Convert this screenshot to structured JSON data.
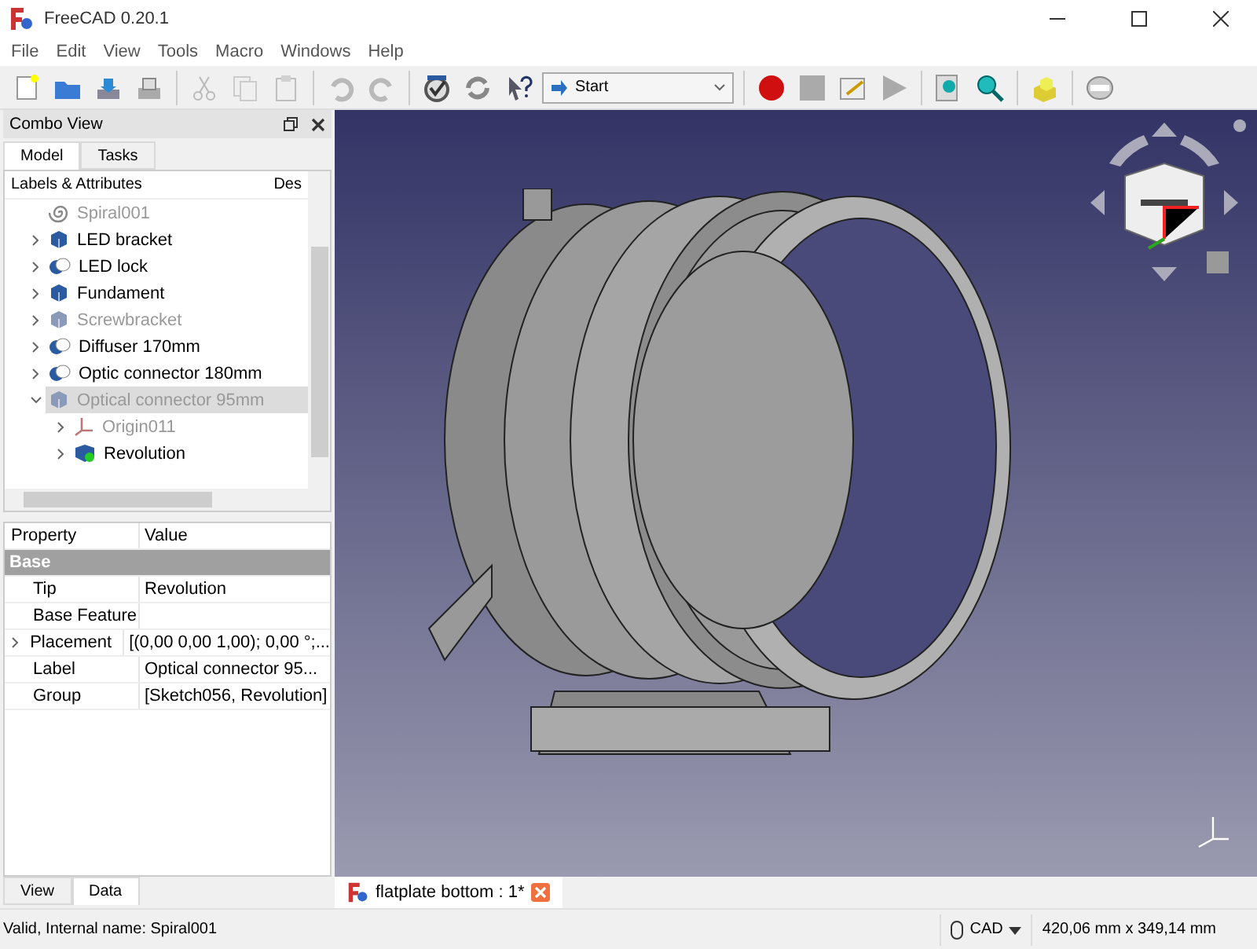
{
  "window": {
    "title": "FreeCAD 0.20.1"
  },
  "menu": [
    "File",
    "Edit",
    "View",
    "Tools",
    "Macro",
    "Windows",
    "Help"
  ],
  "toolbar": [
    {
      "kind": "new",
      "disabled": false
    },
    {
      "kind": "open",
      "disabled": false
    },
    {
      "kind": "save",
      "disabled": false
    },
    {
      "kind": "print",
      "disabled": false
    },
    {
      "kind": "cut",
      "disabled": true
    },
    {
      "kind": "copy",
      "disabled": true
    },
    {
      "kind": "paste",
      "disabled": true
    },
    {
      "kind": "undo",
      "disabled": true
    },
    {
      "kind": "redo",
      "disabled": true
    },
    {
      "kind": "refresh-check",
      "disabled": false
    },
    {
      "kind": "refresh",
      "disabled": false
    },
    {
      "kind": "whatsthis",
      "disabled": false
    }
  ],
  "workbench": "Start",
  "combo_view": {
    "title": "Combo View",
    "tabs": [
      {
        "label": "Model",
        "selected": true
      },
      {
        "label": "Tasks",
        "selected": false
      }
    ]
  },
  "tree": {
    "columns": [
      "Labels & Attributes",
      "Des"
    ],
    "items": [
      {
        "label": "Spiral001",
        "kind": "spiral",
        "visible": false,
        "selected": false,
        "expandable": false
      },
      {
        "label": "LED bracket",
        "kind": "part",
        "visible": true,
        "selected": false,
        "expandable": true,
        "expanded": false
      },
      {
        "label": "LED lock",
        "kind": "body",
        "visible": true,
        "selected": false,
        "expandable": true,
        "expanded": false
      },
      {
        "label": "Fundament",
        "kind": "part",
        "visible": true,
        "selected": false,
        "expandable": true,
        "expanded": false
      },
      {
        "label": "Screwbracket",
        "kind": "part",
        "visible": false,
        "selected": false,
        "expandable": true,
        "expanded": false
      },
      {
        "label": "Diffuser 170mm",
        "kind": "body",
        "visible": true,
        "selected": false,
        "expandable": true,
        "expanded": false
      },
      {
        "label": "Optic connector 180mm",
        "kind": "body",
        "visible": true,
        "selected": false,
        "expandable": true,
        "expanded": false
      },
      {
        "label": "Optical connector 95mm",
        "kind": "part",
        "visible": false,
        "selected": true,
        "expandable": true,
        "expanded": true,
        "children": [
          {
            "label": "Origin011",
            "kind": "origin",
            "visible": false,
            "selected": false,
            "expandable": true,
            "expanded": false
          },
          {
            "label": "Revolution",
            "kind": "revolution",
            "visible": true,
            "selected": false,
            "expandable": true,
            "expanded": false
          }
        ]
      }
    ]
  },
  "properties": {
    "columns": [
      "Property",
      "Value"
    ],
    "rows": [
      {
        "kind": "group",
        "name": "Base",
        "expandable": false
      },
      {
        "kind": "property",
        "name": "Tip",
        "value": "Revolution",
        "expandable": false
      },
      {
        "kind": "property",
        "name": "Base Feature",
        "expandable": false
      },
      {
        "kind": "property",
        "name": "Placement",
        "value": "[(0,00 0,00 1,00); 0,00 °;...",
        "expandable": true
      },
      {
        "kind": "property",
        "name": "Label",
        "value": "Optical connector 95...",
        "expandable": false
      },
      {
        "kind": "property",
        "name": "Group",
        "value": "[Sketch056, Revolution]",
        "expandable": false
      }
    ]
  },
  "bottom_tabs": [
    {
      "label": "View",
      "selected": false
    },
    {
      "label": "Data",
      "selected": true
    }
  ],
  "document_tab": {
    "label": "flatplate bottom : 1*"
  },
  "status_bar": {
    "message": "Valid, Internal name: Spiral001",
    "navigation": "CAD",
    "dimensions": "420,06 mm x 349,14 mm"
  }
}
